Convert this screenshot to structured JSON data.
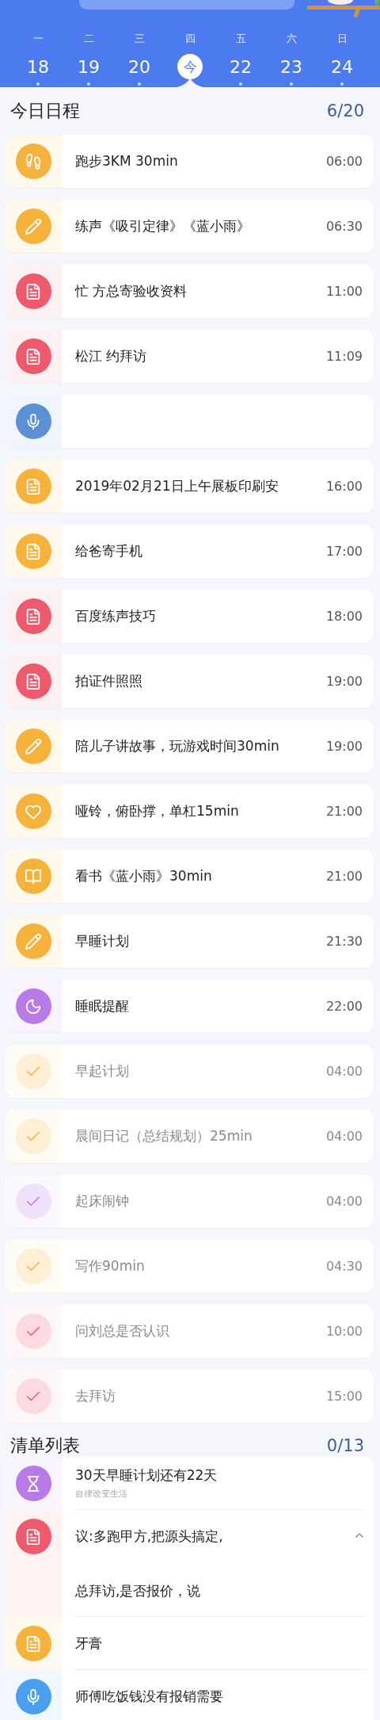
{
  "week": [
    {
      "weekday": "一",
      "date": "18",
      "selected": false
    },
    {
      "weekday": "二",
      "date": "19",
      "selected": false
    },
    {
      "weekday": "三",
      "date": "20",
      "selected": false
    },
    {
      "weekday": "四",
      "date": "今",
      "selected": true
    },
    {
      "weekday": "五",
      "date": "22",
      "selected": false
    },
    {
      "weekday": "六",
      "date": "23",
      "selected": false
    },
    {
      "weekday": "日",
      "date": "24",
      "selected": false
    }
  ],
  "schedule": {
    "title": "今日日程",
    "count": "6/20",
    "items": [
      {
        "kind": "run",
        "title": "跑步3KM 30min",
        "time": "06:00",
        "color": "#f7b23b",
        "done": false
      },
      {
        "kind": "write",
        "title": "练声《吸引定律》《蓝小雨》",
        "time": "06:30",
        "color": "#f7b23b",
        "done": false
      },
      {
        "kind": "note",
        "title": "忙 方总寄验收资料",
        "time": "11:00",
        "color": "#ee5a6c",
        "done": false
      },
      {
        "kind": "note",
        "title": "松江 约拜访",
        "time": "11:09",
        "color": "#ee5a6c",
        "done": false
      },
      {
        "kind": "voice",
        "color": "#5b8fd6",
        "done": false
      },
      {
        "kind": "note",
        "title": "2019年02月21日上午展板印刷安",
        "time": "16:00",
        "color": "#f7b23b",
        "done": false
      },
      {
        "kind": "note",
        "title": "给爸寄手机",
        "time": "17:00",
        "color": "#f7b23b",
        "done": false
      },
      {
        "kind": "note",
        "title": "百度练声技巧",
        "time": "18:00",
        "color": "#ee5a6c",
        "done": false
      },
      {
        "kind": "note",
        "title": "拍证件照照",
        "time": "19:00",
        "color": "#ee5a6c",
        "done": false
      },
      {
        "kind": "write",
        "title": "陪儿子讲故事，玩游戏时间30min",
        "time": "19:00",
        "color": "#f7b23b",
        "done": false
      },
      {
        "kind": "exercise",
        "title": "哑铃，俯卧撑，单杠15min",
        "time": "21:00",
        "color": "#f7b23b",
        "done": false
      },
      {
        "kind": "read",
        "title": "看书《蓝小雨》30min",
        "time": "21:00",
        "color": "#f7b23b",
        "done": false
      },
      {
        "kind": "write",
        "title": "早睡计划",
        "time": "21:30",
        "color": "#f7b23b",
        "done": false
      },
      {
        "kind": "sleep",
        "title": "睡眠提醒",
        "time": "22:00",
        "color": "#b77ae6",
        "done": false
      },
      {
        "kind": "note",
        "title": "早起计划",
        "time": "04:00",
        "color": "#f7b23b",
        "done": true
      },
      {
        "kind": "note",
        "title": "晨间日记（总结规划）25min",
        "time": "04:00",
        "color": "#f7b23b",
        "done": true
      },
      {
        "kind": "note",
        "title": "起床闹钟",
        "time": "04:00",
        "color": "#b77ae6",
        "done": true
      },
      {
        "kind": "note",
        "title": "写作90min",
        "time": "04:30",
        "color": "#f7b23b",
        "done": true
      },
      {
        "kind": "note",
        "title": "问刘总是否认识",
        "time": "10:00",
        "color": "#ee5a6c",
        "done": true
      },
      {
        "kind": "note",
        "title": "去拜访",
        "time": "15:00",
        "color": "#ee5a6c",
        "done": true
      }
    ]
  },
  "checklist": {
    "title": "清单列表",
    "count": "0/13",
    "items": [
      {
        "kind": "timer",
        "title": "30天早睡计划还有22天",
        "subtitle": "自律改变生活",
        "color": "#b77ae6"
      },
      {
        "kind": "note",
        "lines": [
          "议:多跑甲方,把源头搞定,",
          "总拜访,是否报价，说"
        ],
        "color": "#ee5a6c",
        "expanded": true
      },
      {
        "kind": "note",
        "title": "牙膏",
        "color": "#f7b23b"
      },
      {
        "kind": "voice",
        "title": "师傅吃饭钱没有报销需要",
        "color": "#4a9ff0"
      }
    ]
  }
}
